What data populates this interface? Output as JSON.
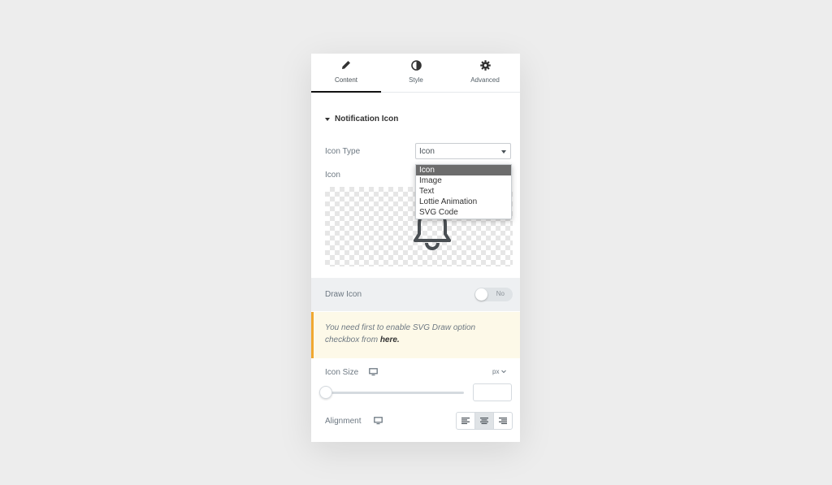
{
  "tabs": [
    {
      "label": "Content",
      "icon": "pencil-icon",
      "active": true
    },
    {
      "label": "Style",
      "icon": "contrast-icon",
      "active": false
    },
    {
      "label": "Advanced",
      "icon": "gear-icon",
      "active": false
    }
  ],
  "section": {
    "title": "Notification Icon"
  },
  "icon_type": {
    "label": "Icon Type",
    "selected": "Icon",
    "options": [
      "Icon",
      "Image",
      "Text",
      "Lottie Animation",
      "SVG Code"
    ]
  },
  "icon": {
    "label": "Icon",
    "preview_icon": "bell-icon"
  },
  "draw_icon": {
    "label": "Draw Icon",
    "toggle_value": "No"
  },
  "notice": {
    "text": "You need first to enable SVG Draw option checkbox from ",
    "link_text": "here."
  },
  "icon_size": {
    "label": "Icon Size",
    "unit": "px",
    "value": ""
  },
  "alignment": {
    "label": "Alignment",
    "options": [
      "left",
      "center",
      "right"
    ],
    "selected": "center"
  },
  "colors": {
    "accent": "#f0a830",
    "tab_active": "#111111"
  }
}
